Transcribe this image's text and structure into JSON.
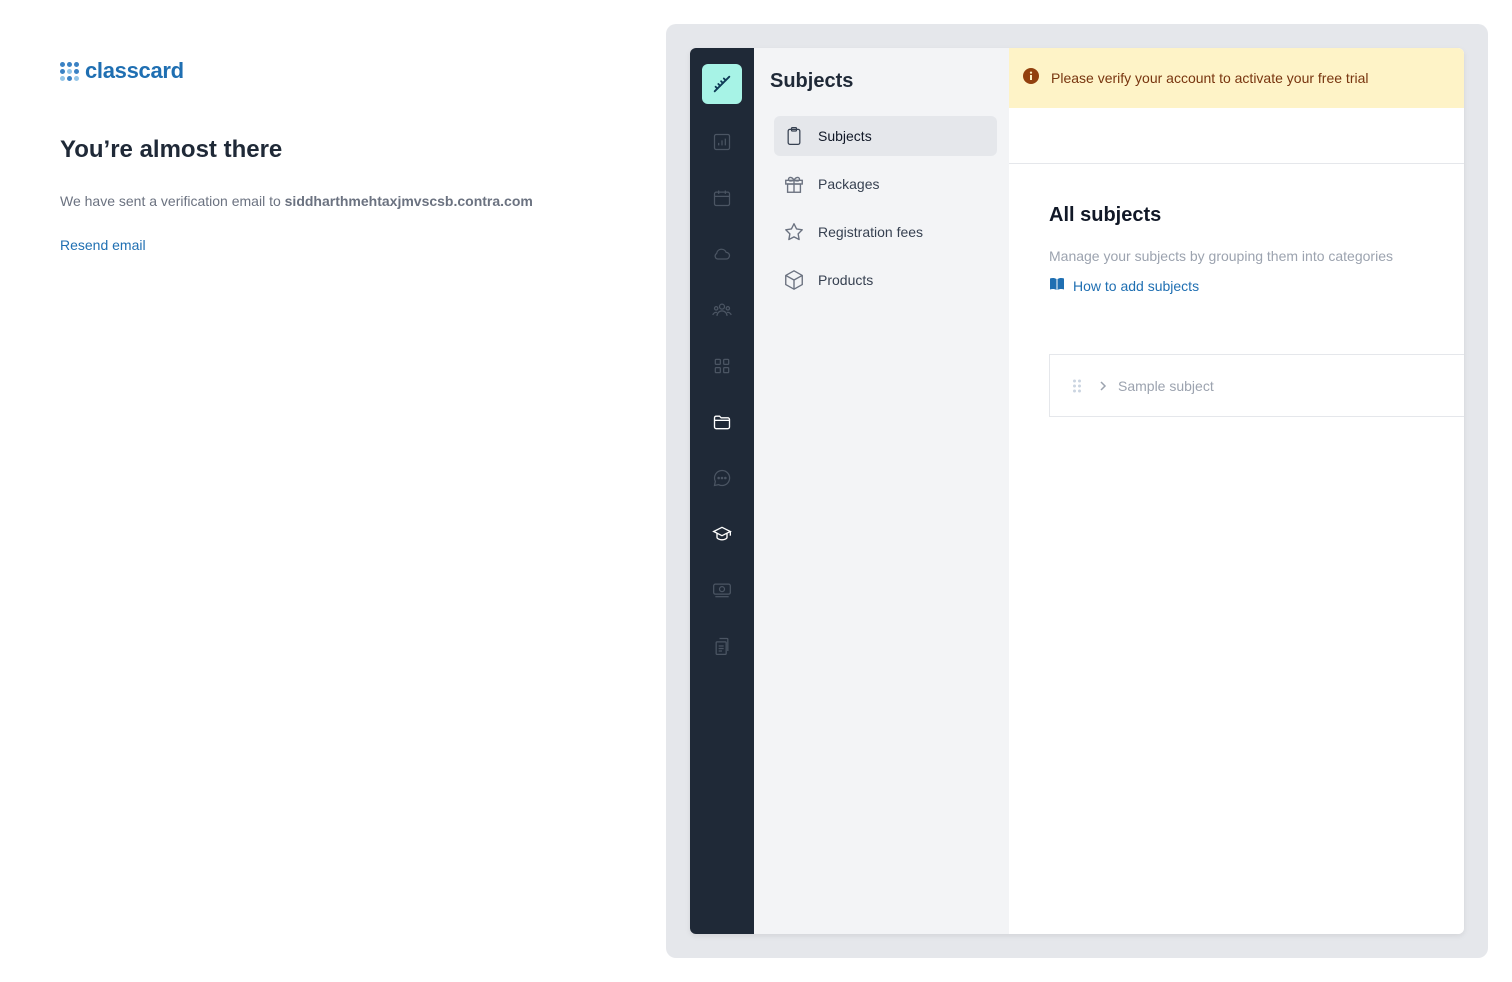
{
  "brand": {
    "name": "classcard"
  },
  "verify": {
    "headline": "You’re almost there",
    "message_prefix": "We have sent a verification email to ",
    "email": "siddharthmehtaxjmvscsb.contra.com",
    "resend_label": "Resend email"
  },
  "preview": {
    "rail_icons": [
      "brand-tool-icon",
      "reports-icon",
      "calendar-icon",
      "cloud-icon",
      "people-icon",
      "apps-icon",
      "folder-icon",
      "chat-icon",
      "graduation-cap-icon",
      "payments-icon",
      "documents-icon"
    ],
    "subnav": {
      "title": "Subjects",
      "items": [
        {
          "label": "Subjects",
          "icon": "clipboard-icon",
          "active": true
        },
        {
          "label": "Packages",
          "icon": "gift-icon",
          "active": false
        },
        {
          "label": "Registration fees",
          "icon": "star-icon",
          "active": false
        },
        {
          "label": "Products",
          "icon": "box-icon",
          "active": false
        }
      ]
    },
    "banner": {
      "text": "Please verify your account to activate your free trial"
    },
    "main": {
      "title": "All subjects",
      "description": "Manage your subjects by grouping them into categories",
      "help_link": "How to add subjects",
      "subjects": [
        {
          "name": "Sample subject"
        }
      ]
    },
    "colors": {
      "rail_bg": "#1f2937",
      "accent": "#1f6fb2",
      "banner_bg": "#fef3c7",
      "brand_tile": "#a7f3e6"
    }
  }
}
